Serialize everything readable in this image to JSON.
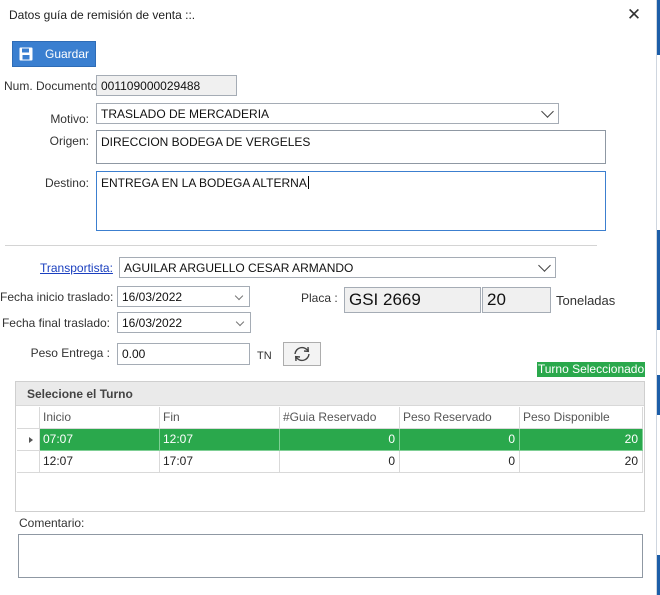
{
  "window": {
    "title": "Datos guía de remisión de venta ::.",
    "close_glyph": "✕"
  },
  "toolbar": {
    "save_label": "Guardar",
    "save_icon": "floppy-disk-icon"
  },
  "form": {
    "doc_label": "Num. Documento:",
    "doc_value": "001109000029488",
    "motivo_label": "Motivo:",
    "motivo_value": "TRASLADO DE MERCADERIA",
    "origen_label": "Origen:",
    "origen_value": "DIRECCION BODEGA DE VERGELES",
    "destino_label": "Destino:",
    "destino_value": "ENTREGA EN LA BODEGA ALTERNA",
    "transportista_label": "Transportista:",
    "transportista_value": "AGUILAR ARGUELLO CESAR ARMANDO",
    "fecha_inicio_label": "Fecha inicio traslado:",
    "fecha_inicio_value": "16/03/2022",
    "fecha_final_label": "Fecha final traslado:",
    "fecha_final_value": "16/03/2022",
    "placa_label": "Placa :",
    "placa_value": "GSI 2669",
    "capacidad_value": "20",
    "toneladas_label": "Toneladas",
    "peso_label": "Peso Entrega :",
    "peso_value": "0.00",
    "peso_unit": "TN",
    "refresh_icon": "refresh-icon"
  },
  "turno": {
    "badge": "Turno Seleccionado",
    "group_title": "Selecione el Turno",
    "columns": [
      "Inicio",
      "Fin",
      "#Guia Reservado",
      "Peso Reservado",
      "Peso Disponible"
    ],
    "rows": [
      [
        "07:07",
        "12:07",
        "0",
        "0",
        "20"
      ],
      [
        "12:07",
        "17:07",
        "0",
        "0",
        "20"
      ]
    ],
    "selected_color": "#2aa84c"
  },
  "comentario": {
    "label": "Comentario:",
    "value": ""
  }
}
